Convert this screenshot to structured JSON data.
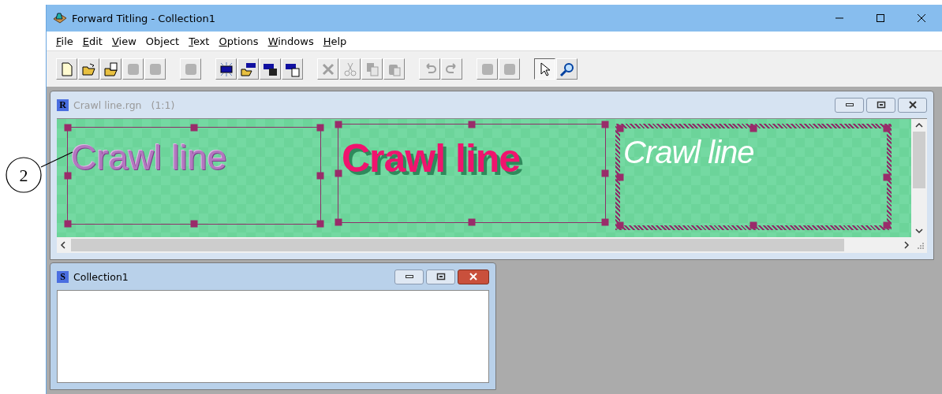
{
  "window": {
    "title": "Forward Titling - Collection1"
  },
  "menu": [
    {
      "label": "File",
      "underline_first": true
    },
    {
      "label": "Edit",
      "underline_first": true
    },
    {
      "label": "View",
      "underline_first": true
    },
    {
      "label": "Object",
      "underline_first": false
    },
    {
      "label": "Text",
      "underline_first": true
    },
    {
      "label": "Options",
      "underline_first": true
    },
    {
      "label": "Windows",
      "underline_first": true
    },
    {
      "label": "Help",
      "underline_first": true
    }
  ],
  "toolbar": [
    [
      {
        "kind": "new",
        "disabled": false,
        "selected": false
      },
      {
        "kind": "open",
        "disabled": false,
        "selected": false
      },
      {
        "kind": "open-doc",
        "disabled": false,
        "selected": false
      },
      {
        "kind": "blank",
        "disabled": true,
        "selected": false
      },
      {
        "kind": "blank",
        "disabled": true,
        "selected": false
      }
    ],
    [
      {
        "kind": "blank",
        "disabled": true,
        "selected": false
      }
    ],
    [
      {
        "kind": "film-new",
        "disabled": false,
        "selected": false
      },
      {
        "kind": "film-open",
        "disabled": false,
        "selected": false
      },
      {
        "kind": "film-save",
        "disabled": false,
        "selected": false
      },
      {
        "kind": "film-doc",
        "disabled": false,
        "selected": false
      }
    ],
    [
      {
        "kind": "delete",
        "disabled": true,
        "selected": false
      },
      {
        "kind": "cut",
        "disabled": true,
        "selected": false
      },
      {
        "kind": "copy",
        "disabled": true,
        "selected": false
      },
      {
        "kind": "paste",
        "disabled": true,
        "selected": false
      }
    ],
    [
      {
        "kind": "undo",
        "disabled": true,
        "selected": false
      },
      {
        "kind": "redo",
        "disabled": true,
        "selected": false
      }
    ],
    [
      {
        "kind": "blank",
        "disabled": true,
        "selected": false
      },
      {
        "kind": "blank",
        "disabled": true,
        "selected": false
      }
    ],
    [
      {
        "kind": "pointer",
        "disabled": false,
        "selected": true
      },
      {
        "kind": "zoom",
        "disabled": false,
        "selected": false
      }
    ]
  ],
  "region_window": {
    "icon_letter": "R",
    "title": "Crawl line.rgn",
    "scale": "(1:1)",
    "active": false,
    "objects": [
      {
        "kind": "embossed",
        "text": "Crawl line",
        "selected": false
      },
      {
        "kind": "shadowed",
        "text": "Crawl line",
        "selected": false
      },
      {
        "kind": "italic",
        "text": "Crawl line",
        "selected": true
      }
    ]
  },
  "collection_window": {
    "icon_letter": "S",
    "title": "Collection1",
    "active": true
  },
  "callout": {
    "label": "2"
  }
}
